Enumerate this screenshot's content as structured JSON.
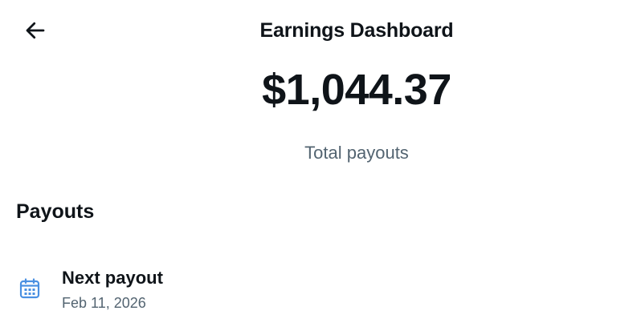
{
  "header": {
    "title": "Earnings Dashboard",
    "back_icon": "arrow-left-icon"
  },
  "summary": {
    "amount": "$1,044.37",
    "label": "Total payouts"
  },
  "payouts": {
    "heading": "Payouts",
    "next": {
      "icon": "calendar-icon",
      "icon_color": "#4a90e2",
      "title": "Next payout",
      "date": "Feb 11, 2026"
    }
  }
}
